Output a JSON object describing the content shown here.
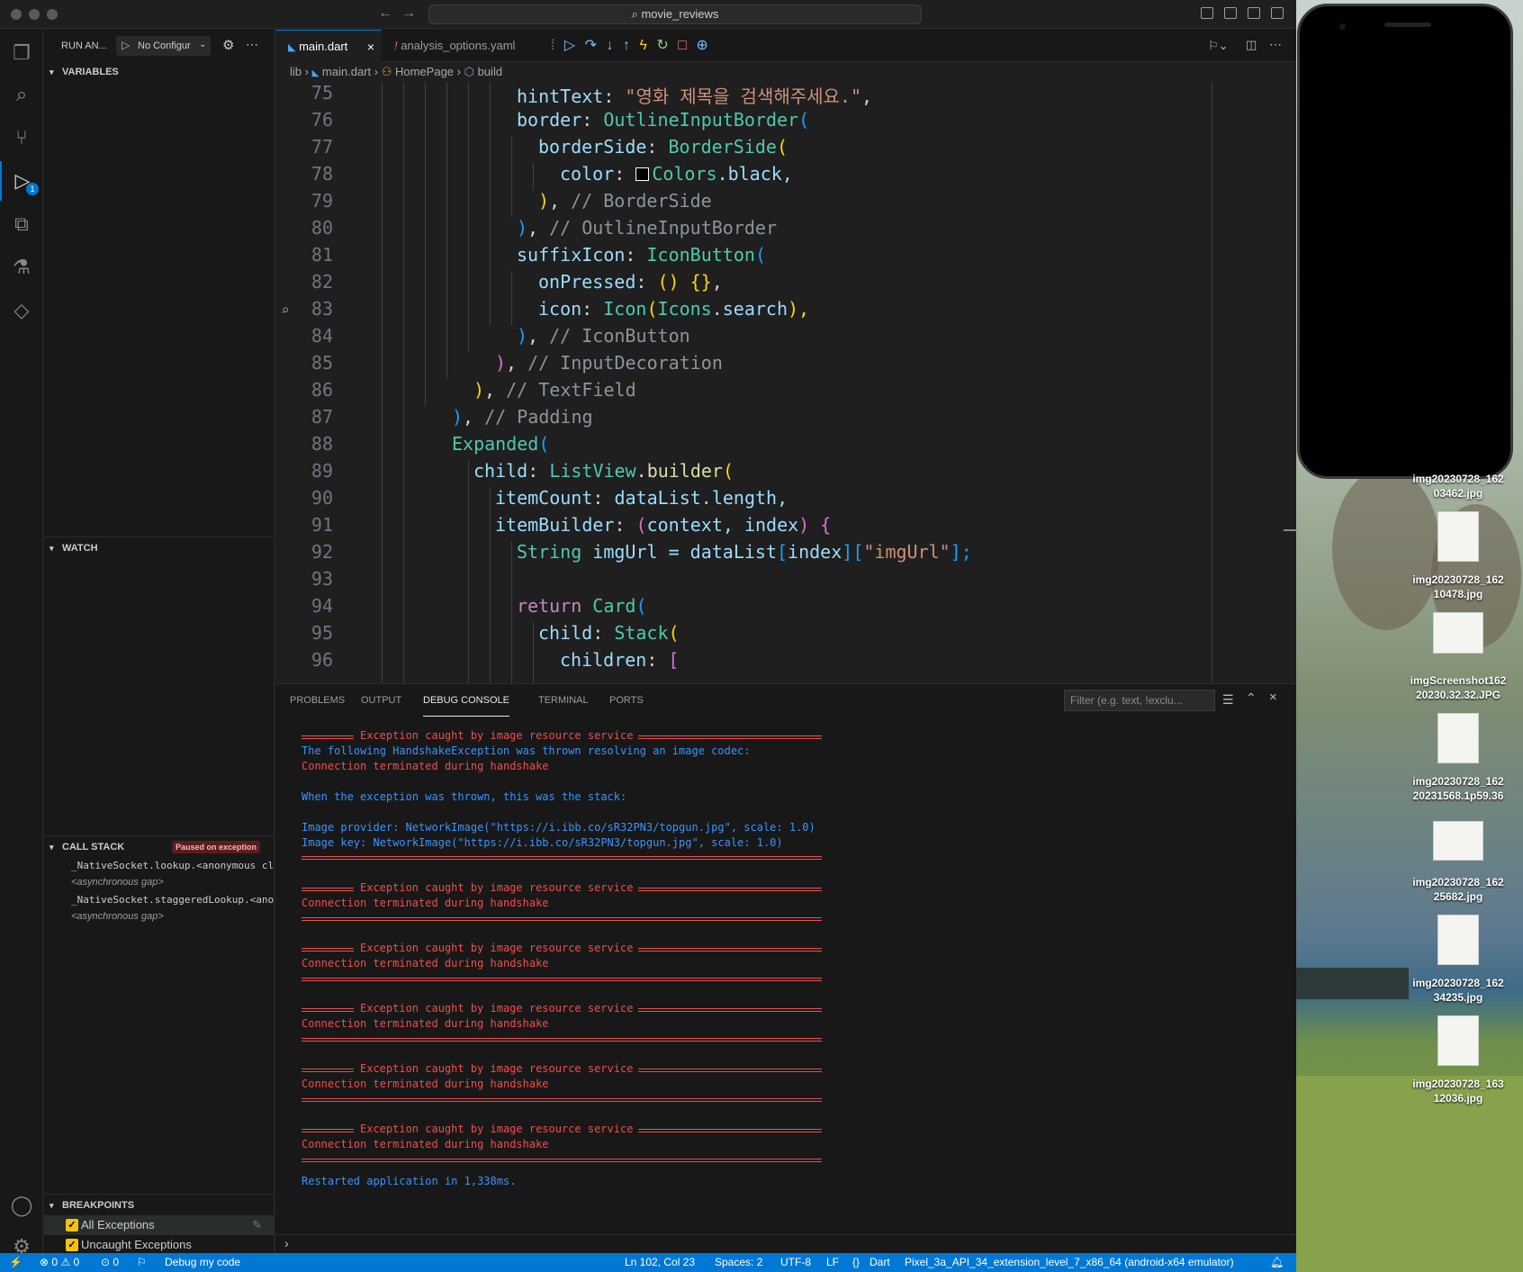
{
  "titlebar": {
    "search": "movie_reviews"
  },
  "sidebar": {
    "run_label": "RUN AN...",
    "config_label": "No Configur",
    "variables_label": "VARIABLES",
    "watch_label": "WATCH",
    "callstack_label": "CALL STACK",
    "paused_badge": "Paused on exception",
    "stack_frames": [
      "_NativeSocket.lookup.<anonymous cl",
      "<asynchronous gap>",
      "_NativeSocket.staggeredLookup.<ano",
      "<asynchronous gap>"
    ],
    "breakpoints_label": "BREAKPOINTS",
    "breakpoints": [
      "All Exceptions",
      "Uncaught Exceptions"
    ]
  },
  "tabs": [
    {
      "label": "main.dart"
    },
    {
      "label": "analysis_options.yaml"
    }
  ],
  "breadcrumb": [
    "lib",
    "main.dart",
    "HomePage",
    "build"
  ],
  "code": {
    "line_numbers": [
      "75",
      "76",
      "77",
      "78",
      "79",
      "80",
      "81",
      "82",
      "83",
      "84",
      "85",
      "86",
      "87",
      "88",
      "89",
      "90",
      "91",
      "92",
      "93",
      "94",
      "95",
      "96"
    ],
    "lines": {
      "l75": {
        "a": "hintText",
        "b": ": ",
        "c": "\"영화 제목을 검색해주세요.\"",
        "d": ","
      },
      "l76": {
        "a": "border",
        "b": ": ",
        "c": "OutlineInputBorder",
        "d": "("
      },
      "l77": {
        "a": "borderSide",
        "b": ": ",
        "c": "BorderSide",
        "d": "("
      },
      "l78": {
        "a": "color",
        "b": ": ",
        "c": "Colors",
        "d": ".black,"
      },
      "l79": {
        "a": ")",
        "b": ", ",
        "c": "// BorderSide"
      },
      "l80": {
        "a": ")",
        "b": ", ",
        "c": "// OutlineInputBorder"
      },
      "l81": {
        "a": "suffixIcon",
        "b": ": ",
        "c": "IconButton",
        "d": "("
      },
      "l82": {
        "a": "onPressed",
        "b": ": ",
        "c": "() {}",
        "d": ","
      },
      "l83": {
        "a": "icon",
        "b": ": ",
        "c": "Icon",
        "d": "(",
        "e": "Icons",
        "f": ".search",
        "g": "),"
      },
      "l84": {
        "a": ")",
        "b": ", ",
        "c": "// IconButton"
      },
      "l85": {
        "a": ")",
        "b": ", ",
        "c": "// InputDecoration"
      },
      "l86": {
        "a": ")",
        "b": ", ",
        "c": "// TextField"
      },
      "l87": {
        "a": ")",
        "b": ", ",
        "c": "// Padding"
      },
      "l88": {
        "a": "Expanded",
        "b": "("
      },
      "l89": {
        "a": "child",
        "b": ": ",
        "c": "ListView",
        "d": ".",
        "e": "builder",
        "f": "("
      },
      "l90": {
        "a": "itemCount",
        "b": ": ",
        "c": "dataList",
        "d": ".length,"
      },
      "l91": {
        "a": "itemBuilder",
        "b": ": ",
        "c": "(",
        "d": "context, index",
        "e": ")",
        "f": " {"
      },
      "l92": {
        "a": "String",
        "b": " imgUrl = ",
        "c": "dataList",
        "d": "[",
        "e": "index",
        "f": "]",
        "g": "[",
        "h": "\"imgUrl\"",
        "i": "];"
      },
      "l94": {
        "a": "return",
        "b": " ",
        "c": "Card",
        "d": "("
      },
      "l95": {
        "a": "child",
        "b": ": ",
        "c": "Stack",
        "d": "("
      },
      "l96": {
        "a": "children",
        "b": ": ",
        "c": "["
      }
    }
  },
  "panel": {
    "tabs": [
      "PROBLEMS",
      "OUTPUT",
      "DEBUG CONSOLE",
      "TERMINAL",
      "PORTS"
    ],
    "filter_placeholder": "Filter (e.g. text, !exclu...",
    "console": {
      "exc_header": "Exception caught by image resource service",
      "line_thrown": "The following HandshakeException was thrown resolving an image codec:",
      "line_conn": "Connection terminated during handshake",
      "line_stack": "When the exception was thrown, this was the stack:",
      "line_provider": "Image provider: NetworkImage(\"https://i.ibb.co/sR32PN3/topgun.jpg\", scale: 1.0)",
      "line_key": "Image key: NetworkImage(\"https://i.ibb.co/sR32PN3/topgun.jpg\", scale: 1.0)",
      "restart": "Restarted application in 1,338ms."
    }
  },
  "statusbar": {
    "errors": "0",
    "warnings": "0",
    "ports": "0",
    "debug": "Debug my code",
    "position": "Ln 102, Col 23",
    "spaces": "Spaces: 2",
    "encoding": "UTF-8",
    "eol": "LF",
    "language": "Dart",
    "device": "Pixel_3a_API_34_extension_level_7_x86_64 (android-x64 emulator)"
  },
  "desktop": {
    "files": [
      {
        "line1": "img20230728_162",
        "line2": "03462.jpg"
      },
      {
        "line1": "img20230728_162",
        "line2": "10478.jpg"
      },
      {
        "line1": "imgScreenshot162",
        "line2": "20230.32.32.JPG"
      },
      {
        "line1": "img20230728_162",
        "line2": "20231568.1p59.36"
      },
      {
        "line1": "img20230728_162",
        "line2": "25682.jpg"
      },
      {
        "line1": "img20230728_162",
        "line2": "34235.jpg"
      },
      {
        "line1": "img20230728_163",
        "line2": "12036.jpg"
      }
    ]
  },
  "colors": {
    "accent": "#0078d4",
    "error": "#f14c4c",
    "info": "#3794ff",
    "breakpoint": "#f4c20d"
  }
}
